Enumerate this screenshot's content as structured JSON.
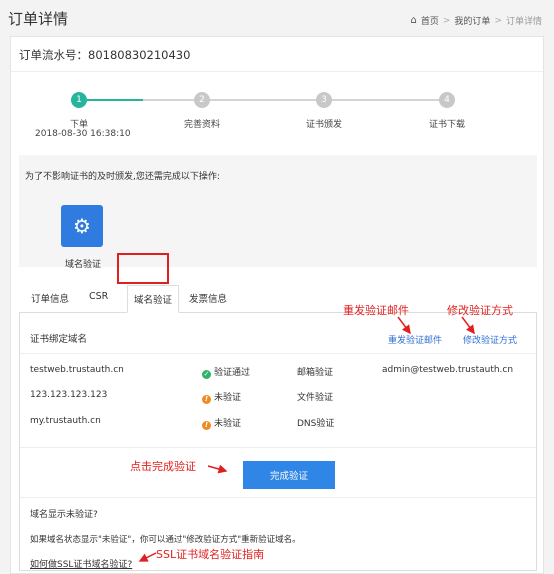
{
  "page_title": "订单详情",
  "breadcrumb": {
    "home_icon": "home-icon",
    "home": "首页",
    "sep": ">",
    "orders": "我的订单",
    "current": "订单详情"
  },
  "order": {
    "serial_label": "订单流水号：80180830210430"
  },
  "stepper": {
    "steps": [
      {
        "number": "1",
        "label": "下单",
        "time": "2018-08-30 16:38:10"
      },
      {
        "number": "2",
        "label": "完善资料"
      },
      {
        "number": "3",
        "label": "证书颁发"
      },
      {
        "number": "4",
        "label": "证书下载"
      }
    ]
  },
  "notice": {
    "text": "为了不影响证书的及时颁发,您还需完成以下操作:",
    "tile_icon": "gear-icon",
    "tile_label": "域名验证"
  },
  "tabs": [
    "订单信息",
    "CSR",
    "域名验证",
    "发票信息"
  ],
  "panel": {
    "title": "证书绑定域名",
    "resend_link": "重发验证邮件",
    "modify_link": "修改验证方式",
    "rows": [
      {
        "domain": "testweb.trustauth.cn",
        "status": "验证通过",
        "method": "邮箱验证",
        "detail": "admin@testweb.trustauth.cn"
      },
      {
        "domain": "123.123.123.123",
        "status": "未验证",
        "method": "文件验证",
        "detail": ""
      },
      {
        "domain": "my.trustauth.cn",
        "status": "未验证",
        "method": "DNS验证",
        "detail": ""
      }
    ],
    "complete_button": "完成验证",
    "faq_title": "域名显示未验证?",
    "faq_text": "如果域名状态显示\"未验证\"，你可以通过\"修改验证方式\"重新验证域名。",
    "faq_link": "如何做SSL证书域名验证?"
  },
  "annotations": {
    "resend": "重发验证邮件",
    "modify": "修改验证方式",
    "complete": "点击完成验证",
    "guide": "SSL证书域名验证指南"
  },
  "colors": {
    "accent": "#26b59a",
    "primary": "#2f86e6",
    "annotation": "#e02020",
    "pending": "#c8c8c8"
  }
}
